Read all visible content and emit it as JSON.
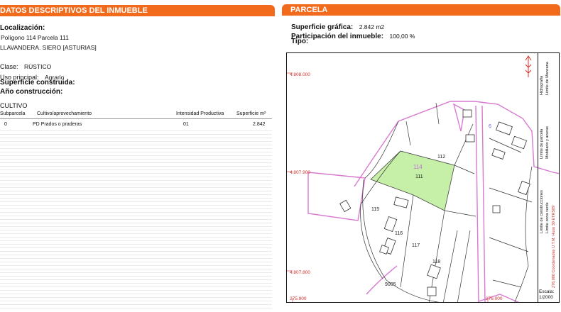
{
  "left": {
    "header": "DATOS DESCRIPTIVOS DEL INMUEBLE",
    "localizacion_label": "Localización:",
    "localizacion_line1": "Polígono 114 Parcela 111",
    "localizacion_line2": "LLAVANDERA. SIERO [ASTURIAS]",
    "clase_label": "Clase:",
    "clase_value": "RÚSTICO",
    "uso_label": "Uso principal:",
    "uso_value": "Agrario",
    "superficie_label": "Superficie construida:",
    "anio_label": "Año construcción:",
    "cultivo_title": "CULTIVO",
    "cultivo_columns": [
      "Subparcela",
      "Cultivo/aprovechamiento",
      "Intensidad Productiva",
      "Superficie m²"
    ],
    "cultivo_rows": [
      {
        "subparcela": "0",
        "cultivo": "PD Prados o praderas",
        "intensidad": "01",
        "superficie": "2.842"
      }
    ]
  },
  "right": {
    "header": "PARCELA",
    "superficie_label": "Superficie gráfica:",
    "superficie_value": "2.842 m2",
    "participacion_label": "Participación del inmueble:",
    "participacion_value": "100,00 %",
    "tipo_label": "Tipo:"
  },
  "map": {
    "coords_y": [
      "4.808.000",
      "4.807.900",
      "4.807.800"
    ],
    "coords_x": [
      "275.900",
      "276.000"
    ],
    "polygon_label": "114",
    "parcel_labels": [
      "112",
      "111",
      "115",
      "116",
      "117",
      "118",
      "9005",
      "6"
    ],
    "highlight_color": "#c6f0a8",
    "boundary_color": "#d77ad0",
    "legend_lines": [
      "Límite de parcela",
      "Límite de construcciones",
      "Mobiliario y aceras",
      "Límite zona verde",
      "Hidrografía",
      "Límite de Manzana"
    ],
    "coordinates_note": "276,000 Coordenadas U.T.M. Huso 30 ETRS89",
    "scale_label": "Escala:",
    "scale_value": "1/2000"
  }
}
